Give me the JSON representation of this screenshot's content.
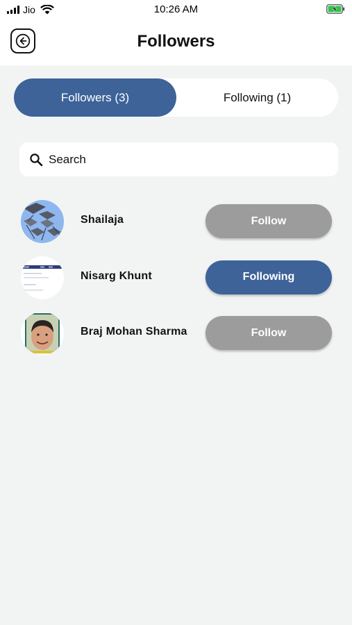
{
  "status_bar": {
    "carrier": "Jio",
    "time": "10:26 AM",
    "icons": [
      "signal-icon",
      "wifi-icon",
      "battery-charging-icon"
    ]
  },
  "header": {
    "title": "Followers",
    "back_icon": "arrow-left-circle-icon"
  },
  "tabs": [
    {
      "label": "Followers (3)",
      "active": true
    },
    {
      "label": "Following (1)",
      "active": false
    }
  ],
  "search": {
    "placeholder": "Search",
    "value": "",
    "icon": "search-icon"
  },
  "users": [
    {
      "name": "Shailaja",
      "action": "Follow",
      "following": false
    },
    {
      "name": "Nisarg Khunt",
      "action": "Following",
      "following": true
    },
    {
      "name": "Braj Mohan Sharma",
      "action": "Follow",
      "following": false
    }
  ],
  "colors": {
    "accent": "#3d6399",
    "follow_button": "#9c9c9c",
    "background": "#f2f4f4"
  }
}
